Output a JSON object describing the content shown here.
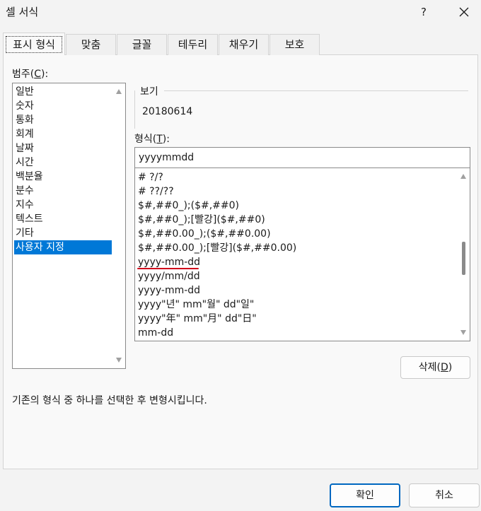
{
  "window": {
    "title": "셀 서식",
    "help": "?"
  },
  "tabs": [
    {
      "label": "표시 형식",
      "active": true
    },
    {
      "label": "맞춤"
    },
    {
      "label": "글꼴"
    },
    {
      "label": "테두리"
    },
    {
      "label": "채우기"
    },
    {
      "label": "보호"
    }
  ],
  "category": {
    "label": "범주(",
    "mnemonic": "C",
    "label_end": "):",
    "items": [
      "일반",
      "숫자",
      "통화",
      "회계",
      "날짜",
      "시간",
      "백분율",
      "분수",
      "지수",
      "텍스트",
      "기타",
      "사용자 지정"
    ],
    "selected": "사용자 지정"
  },
  "preview": {
    "label": "보기",
    "value": "20180614"
  },
  "format": {
    "label": "형식(",
    "mnemonic": "T",
    "label_end": "):",
    "value": "yyyymmdd",
    "items": [
      "# ?/?",
      "# ??/??",
      "$#,##0_);($#,##0)",
      "$#,##0_);[빨강]($#,##0)",
      "$#,##0.00_);($#,##0.00)",
      "$#,##0.00_);[빨강]($#,##0.00)",
      "yyyy-mm-dd",
      "yyyy/mm/dd",
      "yyyy-mm-dd",
      "yyyy\"년\" mm\"월\" dd\"일\"",
      "yyyy\"年\" mm\"月\" dd\"日\"",
      "mm-dd"
    ],
    "highlighted_index": 6,
    "highlight_color": "#d0021b"
  },
  "delete_button": {
    "label": "삭제(",
    "mnemonic": "D",
    "label_end": ")"
  },
  "description": "기존의 형식 중 하나를 선택한 후 변형시킵니다.",
  "footer": {
    "ok": "확인",
    "cancel": "취소"
  },
  "colors": {
    "accent": "#0078d7",
    "primary_border": "#0067c0"
  }
}
